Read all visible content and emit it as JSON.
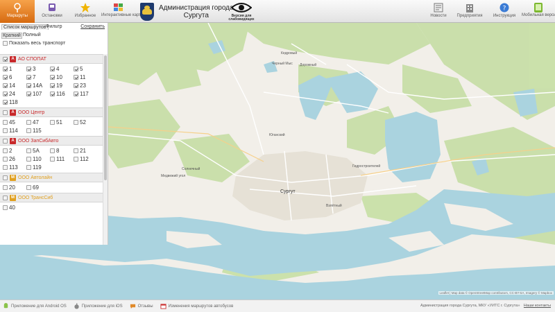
{
  "nav": {
    "routes": "Маршруты",
    "stops": "Остановки",
    "favorites": "Избранное",
    "interactive_maps": "Интерактивные карты",
    "news": "Новости",
    "enterprises": "Предприятия",
    "instructions": "Инструкция",
    "mobile": "Мобильная версия"
  },
  "brand": {
    "line1": "Администрация города",
    "line2": "Сургута",
    "eye_line1": "Версия для",
    "eye_line2": "слабовидящих"
  },
  "sidebar": {
    "tab_list": "Список маршрутов",
    "tab_filter": "Фильтр",
    "save": "Сохранить",
    "sub_short": "Краткий",
    "sub_full": "Полный",
    "show_all": "Показать весь транспорт",
    "groups": [
      {
        "name": "АО СПОПАТ",
        "badge": "А",
        "color": "red",
        "checked": true,
        "routes": [
          "1",
          "3",
          "4",
          "5",
          "6",
          "7",
          "10",
          "11",
          "14",
          "14А",
          "19",
          "23",
          "24",
          "107",
          "116",
          "117",
          "118"
        ]
      },
      {
        "name": "ООО Центр",
        "badge": "А",
        "color": "red",
        "checked": false,
        "routes": [
          "45",
          "47",
          "51",
          "52",
          "114",
          "115"
        ]
      },
      {
        "name": "ООО ЗапСибАвто",
        "badge": "А",
        "color": "red",
        "checked": false,
        "routes": [
          "2",
          "5А",
          "8",
          "21",
          "26",
          "110",
          "111",
          "112",
          "113",
          "119"
        ]
      },
      {
        "name": "ООО Автолайн",
        "badge": "М",
        "color": "orange",
        "checked": false,
        "routes": [
          "20",
          "69"
        ]
      },
      {
        "name": "ООО ТрансСиб",
        "badge": "М",
        "color": "orange",
        "checked": false,
        "routes": [
          "40"
        ]
      }
    ]
  },
  "map": {
    "city_label": "Сургут",
    "places": [
      "Кедровый",
      "Черный Мыс",
      "Дорожный",
      "Юганский",
      "Солнечный",
      "Взлётный",
      "Медвежий угол",
      "Гидростроителей"
    ],
    "attribution": "Leaflet | Map data © OpenStreetMap contributors, CC-BY-SA, Imagery © Mapbox"
  },
  "footer": {
    "android": "Приложение для Android OS",
    "ios": "Приложение для iOS",
    "feedback": "Отзывы",
    "schedule": "Изменения маршрутов автобусов",
    "right": "Администрация города Сургута, МКУ «УИТС г. Сургута»",
    "contacts": "Наши контакты"
  },
  "colors": {
    "accent": "#e07a20",
    "water": "#aad3df",
    "land": "#f2efe9",
    "forest": "#c8dfa8",
    "brand_red": "#c8282a"
  }
}
